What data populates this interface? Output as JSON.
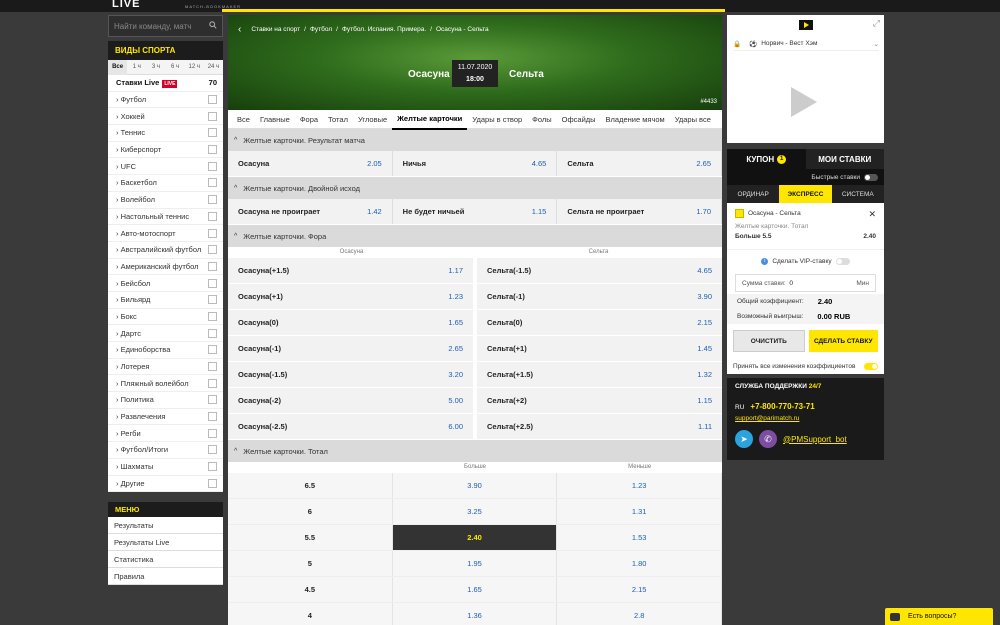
{
  "header": {
    "logo": "LIVE",
    "tagline": "MATCH-BOOKMAKER"
  },
  "search": {
    "placeholder": "Найти команду, матч"
  },
  "sports_panel": {
    "title": "ВИДЫ СПОРТА",
    "time_filters": [
      "Все",
      "1 ч",
      "3 ч",
      "6 ч",
      "12 ч",
      "24 ч"
    ],
    "live": {
      "label": "Ставки Live",
      "badge": "LIVE",
      "count": "70"
    },
    "items": [
      "Футбол",
      "Хоккей",
      "Теннис",
      "Киберспорт",
      "UFC",
      "Баскетбол",
      "Волейбол",
      "Настольный теннис",
      "Авто-мотоспорт",
      "Австралийский футбол",
      "Американский футбол",
      "Бейсбол",
      "Бильярд",
      "Бокс",
      "Дартс",
      "Единоборства",
      "Лотерея",
      "Пляжный волейбол",
      "Политика",
      "Развлечения",
      "Регби",
      "Футбол/Итоги",
      "Шахматы",
      "Другие"
    ]
  },
  "menu": {
    "title": "МЕНЮ",
    "items": [
      "Результаты",
      "Результаты Live",
      "Статистика",
      "Правила"
    ]
  },
  "event": {
    "breadcrumbs": [
      "Ставки на спорт",
      "Футбол",
      "Футбол. Испания. Примера.",
      "Осасуна - Сельта"
    ],
    "home": "Осасуна",
    "away": "Сельта",
    "date": "11.07.2020",
    "time": "18:00",
    "id": "#4433"
  },
  "market_tabs": [
    "Все",
    "Главные",
    "Фора",
    "Тотал",
    "Угловые",
    "Желтые карточки",
    "Удары в створ",
    "Фолы",
    "Офсайды",
    "Владение мячом",
    "Удары все"
  ],
  "markets": {
    "result": {
      "title": "Желтые карточки. Результат матча",
      "cells": [
        {
          "name": "Осасуна",
          "odd": "2.05"
        },
        {
          "name": "Ничья",
          "odd": "4.65"
        },
        {
          "name": "Сельта",
          "odd": "2.65"
        }
      ]
    },
    "double": {
      "title": "Желтые карточки. Двойной исход",
      "cells": [
        {
          "name": "Осасуна не проиграет",
          "odd": "1.42"
        },
        {
          "name": "Не будет ничьей",
          "odd": "1.15"
        },
        {
          "name": "Сельта не проиграет",
          "odd": "1.70"
        }
      ]
    },
    "handicap": {
      "title": "Желтые карточки. Фора",
      "col_left": "Осасуна",
      "col_right": "Сельта",
      "rows": [
        {
          "l": "Осасуна(+1.5)",
          "lo": "1.17",
          "r": "Сельта(-1.5)",
          "ro": "4.65"
        },
        {
          "l": "Осасуна(+1)",
          "lo": "1.23",
          "r": "Сельта(-1)",
          "ro": "3.90"
        },
        {
          "l": "Осасуна(0)",
          "lo": "1.65",
          "r": "Сельта(0)",
          "ro": "2.15"
        },
        {
          "l": "Осасуна(-1)",
          "lo": "2.65",
          "r": "Сельта(+1)",
          "ro": "1.45"
        },
        {
          "l": "Осасуна(-1.5)",
          "lo": "3.20",
          "r": "Сельта(+1.5)",
          "ro": "1.32"
        },
        {
          "l": "Осасуна(-2)",
          "lo": "5.00",
          "r": "Сельта(+2)",
          "ro": "1.15"
        },
        {
          "l": "Осасуна(-2.5)",
          "lo": "6.00",
          "r": "Сельта(+2.5)",
          "ro": "1.11"
        }
      ]
    },
    "total": {
      "title": "Желтые карточки. Тотал",
      "col_over": "Больше",
      "col_under": "Меньше",
      "rows": [
        {
          "t": "6.5",
          "over": "3.90",
          "under": "1.23"
        },
        {
          "t": "6",
          "over": "3.25",
          "under": "1.31"
        },
        {
          "t": "5.5",
          "over": "2.40",
          "under": "1.53",
          "selected": "over"
        },
        {
          "t": "5",
          "over": "1.95",
          "under": "1.80"
        },
        {
          "t": "4.5",
          "over": "1.65",
          "under": "2.15"
        },
        {
          "t": "4",
          "over": "1.36",
          "under": "2.8"
        }
      ]
    }
  },
  "video": {
    "match": "Норвич - Вест Хэм",
    "icons": [
      "youtube-icon",
      "play-icon",
      "expand-icon"
    ]
  },
  "coupon": {
    "tab_coupon": "КУПОН",
    "badge": "1",
    "tab_my_bets": "МОИ СТАВКИ",
    "fast_bets": "Быстрые ставки",
    "bet_types": [
      "ОРДИНАР",
      "ЭКСПРЕСС",
      "СИСТЕМА"
    ],
    "slip": {
      "event": "Осасуна - Сельта",
      "market": "Желтые карточки. Тотал",
      "selection": "Больше 5.5",
      "odd": "2.40"
    },
    "vip": "Сделать VIP-ставку",
    "stake_label": "Сумма ставки:",
    "stake_value": "0",
    "stake_min": "Мин",
    "total_coef_label": "Общий коэффициент:",
    "total_coef": "2.40",
    "win_label": "Возможный выигрыш:",
    "win": "0.00 RUB",
    "clear": "ОЧИСТИТЬ",
    "place": "СДЕЛАТЬ СТАВКУ",
    "accept": "Принять все изменения коэффициентов"
  },
  "support": {
    "title": "СЛУЖБА ПОДДЕРЖКИ",
    "title_accent": "24/7",
    "lang": "RU",
    "phone": "+7-800-770-73-71",
    "email": "support@parimatch.ru",
    "bot": "@PMSupport_bot"
  },
  "chat": {
    "label": "Есть вопросы?"
  },
  "colors": {
    "accent": "#ffe600",
    "odd": "#1d5fb0",
    "live": "#d4002a"
  }
}
